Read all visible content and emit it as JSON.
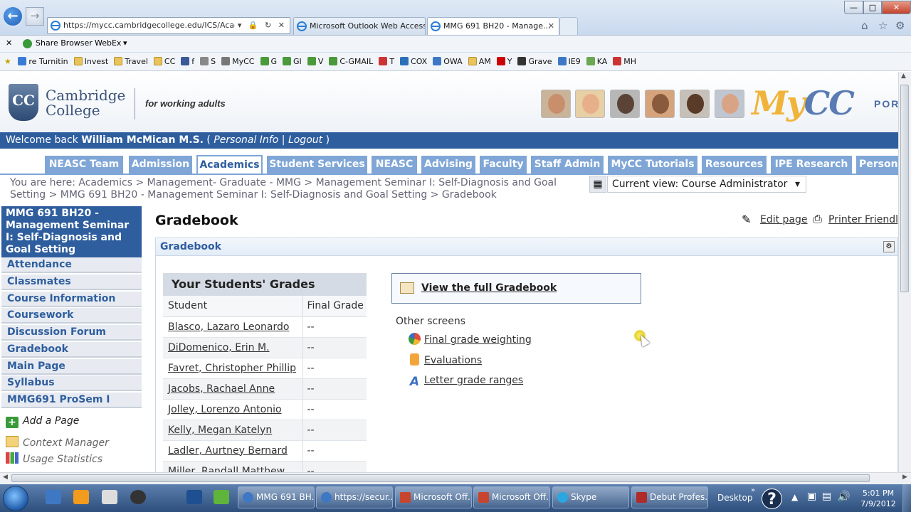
{
  "browser": {
    "address_url": "https://mycc.cambridgecollege.edu/ICS/Acader",
    "tabs": [
      {
        "label": "Microsoft Outlook Web Access"
      },
      {
        "label": "MMG 691 BH20 - Manage..."
      }
    ],
    "command_bar": {
      "share": "Share Browser",
      "webex": "WebEx"
    },
    "favorites": [
      "re Turnitin",
      "Invest",
      "Travel",
      "CC",
      "f",
      "S",
      "MyCC",
      "G",
      "GI",
      "V",
      "C-GMAIL",
      "T",
      "COX",
      "OWA",
      "AM",
      "Y",
      "Grave",
      "IE9",
      "KA",
      "MH"
    ]
  },
  "header": {
    "logo_shield": "CC",
    "logo_line1": "Cambridge",
    "logo_line2": "College",
    "tagline": "for working adults",
    "mycc_my": "My",
    "mycc_cc": "CC",
    "portal": "PORTA"
  },
  "welcome": {
    "prefix": "Welcome back ",
    "name": "William McMican M.S.",
    "open": " ( ",
    "personal_info": "Personal Info",
    "sep": " | ",
    "logout": "Logout",
    "close": " )"
  },
  "nav_tabs": [
    "NEASC Team",
    "Admission",
    "Academics",
    "Student Services",
    "NEASC",
    "Advising",
    "Faculty",
    "Staff Admin",
    "MyCC Tutorials",
    "Resources",
    "IPE Research",
    "Person"
  ],
  "breadcrumb": "You are here:  Academics > Management- Graduate - MMG > Management Seminar I: Self-Diagnosis and Goal Setting > MMG 691 BH20 - Management Seminar I: Self-Diagnosis and Goal Setting > Gradebook",
  "current_view": "Current view: Course Administrator",
  "sidebar": {
    "title": "MMG 691 BH20 - Management Seminar I: Self-Diagnosis and Goal Setting",
    "items": [
      "Attendance",
      "Classmates",
      "Course Information",
      "Coursework",
      "Discussion Forum",
      "Gradebook",
      "Main Page",
      "Syllabus",
      "MMG691 ProSem I"
    ],
    "tools": [
      "Add a Page",
      "Context Manager",
      "Usage Statistics"
    ]
  },
  "main": {
    "title": "Gradebook",
    "edit_page": "Edit page",
    "printer_friendly": "Printer Friendly",
    "portlet_title": "Gradebook",
    "grades_title": "Your Students' Grades",
    "columns": [
      "Student",
      "Final Grade"
    ],
    "students": [
      {
        "name": "Blasco, Lazaro Leonardo",
        "grade": "--"
      },
      {
        "name": "DiDomenico, Erin M.",
        "grade": "--"
      },
      {
        "name": "Favret, Christopher Phillip",
        "grade": "--"
      },
      {
        "name": "Jacobs, Rachael Anne",
        "grade": "--"
      },
      {
        "name": "Jolley, Lorenzo Antonio",
        "grade": "--"
      },
      {
        "name": "Kelly, Megan Katelyn",
        "grade": "--"
      },
      {
        "name": "Ladler, Aurtney Bernard",
        "grade": "--"
      },
      {
        "name": "Miller, Randall Matthew",
        "grade": "--"
      }
    ],
    "view_full": "View the full Gradebook",
    "other_screens": "Other screens",
    "links": [
      "Final grade weighting",
      "Evaluations",
      "Letter grade ranges"
    ]
  },
  "taskbar": {
    "tasks": [
      "MMG 691 BH...",
      "https://secur...",
      "Microsoft Off...",
      "Microsoft Off...",
      "Skype",
      "Debut Profes..."
    ],
    "desktop": "Desktop",
    "time": "5:01 PM",
    "date": "7/9/2012"
  },
  "colors": {
    "brand_blue": "#2f5e9e",
    "tab_blue": "#7fa6d6",
    "logo_gold": "#f0b43a"
  }
}
